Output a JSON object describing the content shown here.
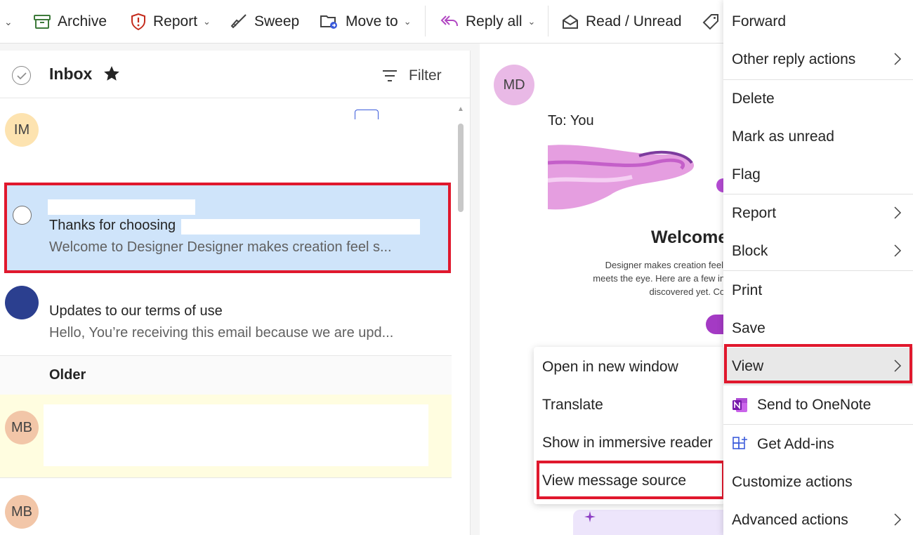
{
  "toolbar": {
    "archive": "Archive",
    "report": "Report",
    "sweep": "Sweep",
    "move_to": "Move to",
    "reply_all": "Reply all",
    "read_unread": "Read / Unread"
  },
  "inbox": {
    "title": "Inbox",
    "filter": "Filter",
    "older_label": "Older",
    "messages": [
      {
        "avatar": "IM",
        "avatar_color": "#fde3b0"
      },
      {
        "subject": "Thanks for choosing",
        "preview": "Welcome to Designer Designer makes creation feel s...",
        "selected": true
      },
      {
        "avatar_color": "#2b3f8f",
        "subject": "Updates to our terms of use",
        "preview": "Hello, You’re receiving this email because we are upd..."
      },
      {
        "avatar": "MB",
        "avatar_color": "#f2c6a8"
      },
      {
        "avatar": "MB",
        "avatar_color": "#f2c6a8"
      }
    ]
  },
  "reading": {
    "sender_avatar": "MD",
    "sender_avatar_color": "#e9b9e6",
    "to_line": "To:  You",
    "welcome": "Welcome",
    "body_lines": [
      "Designer makes creation feel si",
      "meets the eye. Here are a few incr",
      "discovered yet. Com"
    ]
  },
  "submenu": {
    "items": [
      "Open in new window",
      "Translate",
      "Show in immersive reader",
      "View message source"
    ]
  },
  "context_menu": {
    "items": [
      "Forward",
      "Other reply actions",
      "Delete",
      "Mark as unread",
      "Flag",
      "Report",
      "Block",
      "Print",
      "Save",
      "View",
      "Send to OneNote",
      "Get Add-ins",
      "Customize actions",
      "Advanced actions"
    ]
  },
  "colors": {
    "selection": "#cfe4fa",
    "highlight_red": "#e0182d",
    "accent_purple": "#a43ac4"
  }
}
